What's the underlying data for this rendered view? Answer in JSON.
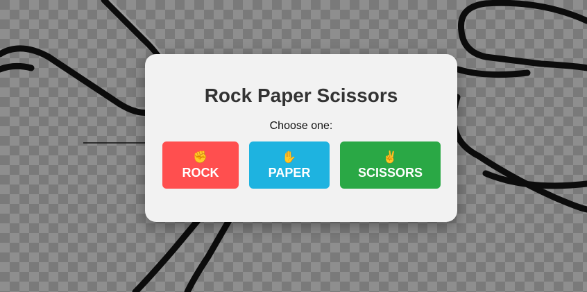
{
  "dialog": {
    "title": "Rock Paper Scissors",
    "prompt": "Choose one:"
  },
  "choices": [
    {
      "icon": "✊",
      "icon_name": "fist-icon",
      "label": "ROCK",
      "color": "#ff4f4f"
    },
    {
      "icon": "✋",
      "icon_name": "raised-hand-icon",
      "label": "PAPER",
      "color": "#1eb3e0"
    },
    {
      "icon": "✌️",
      "icon_name": "victory-hand-icon",
      "label": "SCISSORS",
      "color": "#2aa845"
    }
  ]
}
